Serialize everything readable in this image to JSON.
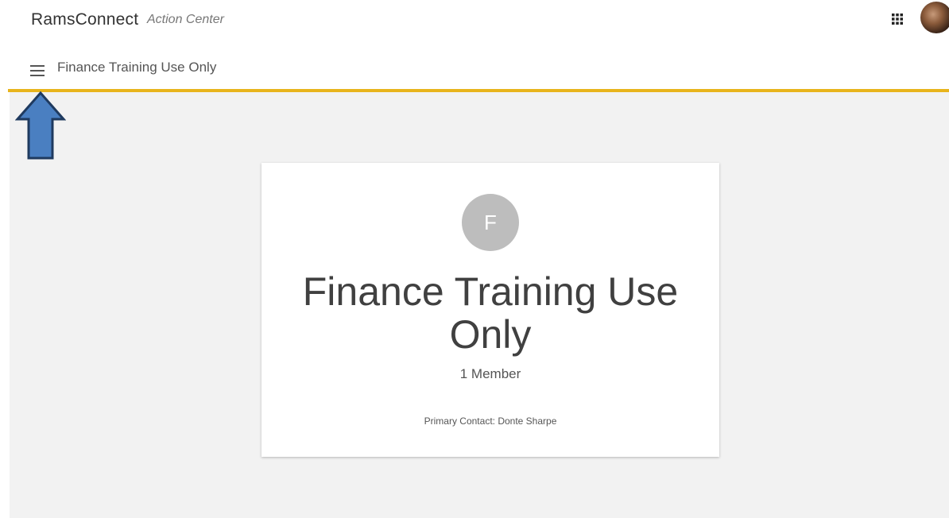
{
  "header": {
    "brand": "RamsConnect",
    "subtitle": "Action Center",
    "apps_icon": "apps-grid-icon",
    "avatar_icon": "user-avatar"
  },
  "subheader": {
    "menu_icon": "hamburger-menu-icon",
    "title": "Finance Training Use Only"
  },
  "colors": {
    "accent": "#e8b41c",
    "annotation_arrow": "#4a7fc1",
    "annotation_arrow_border": "#1f3a5f",
    "card_avatar_bg": "#bdbdbd",
    "content_bg": "#f2f2f2"
  },
  "card": {
    "initial": "F",
    "title": "Finance Training Use Only",
    "members": "1 Member",
    "primary_contact": "Primary Contact: Donte Sharpe"
  }
}
